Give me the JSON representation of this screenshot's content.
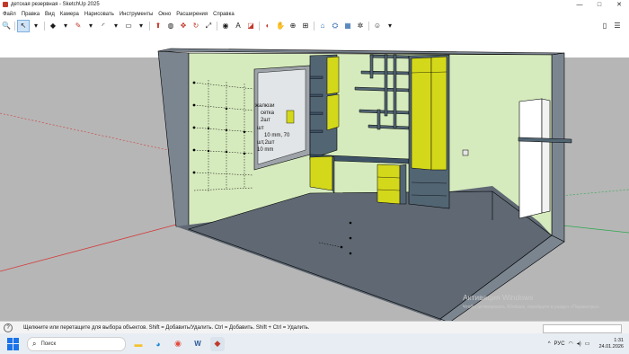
{
  "window": {
    "title": "детская резервная - SketchUp 2025",
    "controls": {
      "minimize": "—",
      "maximize": "□",
      "close": "✕"
    }
  },
  "menu": [
    "Файл",
    "Правка",
    "Вид",
    "Камера",
    "Нарисовать",
    "Инструменты",
    "Окно",
    "Расширения",
    "Справка"
  ],
  "toolbar": {
    "tools": [
      {
        "name": "search-tool",
        "glyph": "🔍"
      },
      {
        "name": "select-tool",
        "glyph": "↖",
        "selected": true
      },
      {
        "name": "select-dropdown",
        "glyph": "▾"
      },
      {
        "name": "eraser-tool",
        "glyph": "◆"
      },
      {
        "name": "eraser-dropdown",
        "glyph": "▾"
      },
      {
        "name": "pencil-tool",
        "glyph": "✎"
      },
      {
        "name": "pencil-dropdown",
        "glyph": "▾"
      },
      {
        "name": "arc-tool",
        "glyph": "◜"
      },
      {
        "name": "arc-dropdown",
        "glyph": "▾"
      },
      {
        "name": "rectangle-tool",
        "glyph": "▭"
      },
      {
        "name": "rectangle-dropdown",
        "glyph": "▾"
      },
      {
        "name": "pushpull-tool",
        "glyph": "⬆"
      },
      {
        "name": "offset-tool",
        "glyph": "◍"
      },
      {
        "name": "move-tool",
        "glyph": "✥"
      },
      {
        "name": "rotate-tool",
        "glyph": "↻"
      },
      {
        "name": "scale-tool",
        "glyph": "⤢"
      },
      {
        "name": "tape-tool",
        "glyph": "◉"
      },
      {
        "name": "text-tool",
        "glyph": "A"
      },
      {
        "name": "paint-tool",
        "glyph": "◪"
      },
      {
        "name": "orbit-tool",
        "glyph": "◐"
      },
      {
        "name": "pan-tool",
        "glyph": "✋"
      },
      {
        "name": "zoom-tool",
        "glyph": "⊕"
      },
      {
        "name": "zoom-extents-tool",
        "glyph": "⊞"
      },
      {
        "name": "warehouse-tool",
        "glyph": "⌂"
      },
      {
        "name": "extension-tool",
        "glyph": "⛭"
      },
      {
        "name": "scenes-tool",
        "glyph": "▦"
      },
      {
        "name": "styles-tool",
        "glyph": "✲"
      },
      {
        "name": "account-tool",
        "glyph": "☺"
      },
      {
        "name": "account-dropdown",
        "glyph": "▾"
      }
    ],
    "right": [
      {
        "name": "new-file-icon",
        "glyph": "▯"
      },
      {
        "name": "panels-icon",
        "glyph": "☰"
      }
    ]
  },
  "viewport": {
    "colors": {
      "sky": "#ffffff",
      "ground": "#b6b6b6",
      "floor": "#5f6873",
      "wall": "#d6ebbd",
      "shell": "#7b8590",
      "yellow": "#d4d81a",
      "cabinet": "#526573",
      "shelf": "#3e5366"
    },
    "wall_notes": [
      "жалюзи",
      "сетка",
      "2шт",
      "шт",
      "10 mm, 70",
      "шт,2шт",
      "10 mm"
    ],
    "watermark": {
      "title": "Активация Windows",
      "subtitle": "Чтобы активировать Windows, перейдите в раздел «Параметры»."
    }
  },
  "status": {
    "help_icon": "?",
    "text": "Щелкните или перетащите для выбора объектов. Shift = Добавить/Удалить. Ctrl = Добавить. Shift + Ctrl = Удалить."
  },
  "taskbar": {
    "search_placeholder": "Поиск",
    "apps": [
      {
        "name": "file-explorer-icon",
        "glyph": "▬",
        "color": "#f2c230"
      },
      {
        "name": "edge-icon",
        "glyph": "◕",
        "color": "#1f8ad6"
      },
      {
        "name": "chrome-icon",
        "glyph": "◉",
        "color": "#e24b3b"
      },
      {
        "name": "word-icon",
        "glyph": "W",
        "color": "#2b579a"
      },
      {
        "name": "sketchup-icon",
        "glyph": "◆",
        "color": "#c0392b"
      }
    ],
    "tray": {
      "chevron": "^",
      "lang": "РУС",
      "time": "1:31",
      "date": "24.01.2026"
    }
  }
}
